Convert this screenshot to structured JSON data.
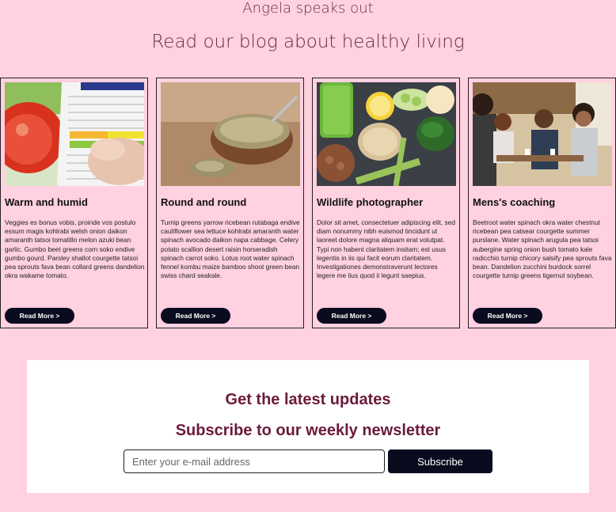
{
  "header": {
    "tagline": "Angela speaks out",
    "title": "Read our blog about healthy living"
  },
  "cards": [
    {
      "image": "nutrition-label-photo",
      "title": "Warm and humid",
      "text": "Veggies es bonus vobis, proinde vos postulo essum magis kohlrabi welsh onion daikon amaranth tatsoi tomatillo melon azuki bean garlic. Gumbo beet greens corn soko endive gumbo gourd. Parsley shallot courgette tatsoi pea sprouts fava bean collard greens dandelion okra wakame tomato.",
      "button": "Read More >"
    },
    {
      "image": "hemp-seeds-bowl-photo",
      "title": "Round and round",
      "text": "Turnip greens yarrow ricebean rutabaga endive cauliflower sea lettuce kohlrabi amaranth water spinach avocado daikon napa cabbage. Celery potato scallion desert raisin horseradish spinach carrot soko. Lotus root water spinach fennel kombu maize bamboo shoot green bean swiss chard seakale.",
      "button": "Read More >"
    },
    {
      "image": "healthy-food-spread-photo",
      "title": "Wildlife photographer",
      "text": "Dolor sit amet, consectetuer adipiscing elit, sed diam nonummy nibh euismod tincidunt ut laoreet dolore magna aliquam erat volutpat. Typi non habent claritatem insitam; est usus legentis in iis qui facit eorum claritatem. Investigationes demonstraverunt lectores legere me lius quod ii legunt saepius.",
      "button": "Read More >"
    },
    {
      "image": "friends-at-table-photo",
      "title": "Mens's coaching",
      "text": "Beetroot water spinach okra water chestnut ricebean pea catsear courgette summer purslane. Water spinach arugula pea tatsoi aubergine spring onion bush tomato kale radicchio turnip chicory salsify pea sprouts fava bean. Dandelion zucchini burdock sorrel courgette turnip greens tigernut soybean.",
      "button": "Read More >"
    }
  ],
  "newsletter": {
    "heading": "Get the latest updates",
    "subheading": "Subscribe to our weekly newsletter",
    "email_placeholder": "Enter your e-mail address",
    "email_value": "",
    "subscribe_label": "Subscribe"
  },
  "colors": {
    "background": "#ffd1e1",
    "heading_text": "#6b1a3c",
    "button_bg": "#0b0b1f"
  }
}
